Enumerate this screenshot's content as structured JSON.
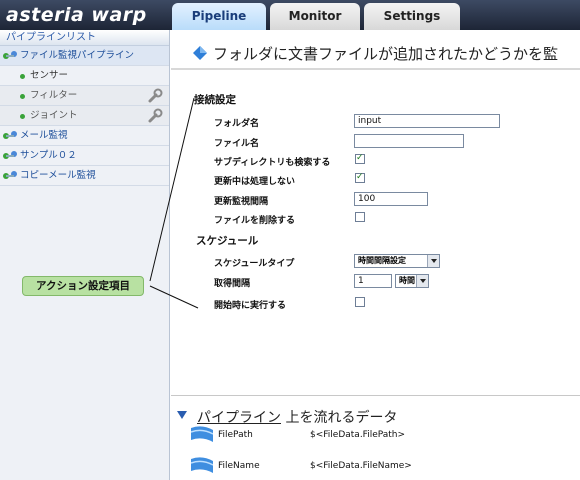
{
  "app": {
    "logo": "asteria warp"
  },
  "tabs": [
    {
      "label": "Pipeline",
      "active": true
    },
    {
      "label": "Monitor",
      "active": false
    },
    {
      "label": "Settings",
      "active": false
    }
  ],
  "sidebar": {
    "header": "パイプラインリスト",
    "items": [
      {
        "label": "ファイル監視パイプライン",
        "level": 1
      },
      {
        "label": "センサー",
        "level": 2
      },
      {
        "label": "フィルター",
        "level": 2
      },
      {
        "label": "ジョイント",
        "level": 2
      },
      {
        "label": "メール監視",
        "level": 1
      },
      {
        "label": "サンプル０２",
        "level": 1
      },
      {
        "label": "コピーメール監視",
        "level": 1
      }
    ]
  },
  "main": {
    "title": "フォルダに文書ファイルが追加されたかどうかを監",
    "section_connection": "接続設定",
    "fields": {
      "folder_label": "フォルダ名",
      "folder_value": "input",
      "file_label": "ファイル名",
      "file_value": "",
      "subdir_label": "サブディレクトリも検索する",
      "subdir_checked": true,
      "skip_updating_label": "更新中は処理しない",
      "skip_updating_checked": true,
      "interval_label": "更新監視間隔",
      "interval_value": "100",
      "delete_label": "ファイルを削除する",
      "delete_checked": false
    },
    "section_schedule": "スケジュール",
    "schedule": {
      "type_label": "スケジュールタイプ",
      "type_value": "時間間隔設定",
      "fetch_label": "取得間隔",
      "fetch_value": "1",
      "fetch_unit": "時間",
      "run_on_start_label": "開始時に実行する",
      "run_on_start_checked": false
    },
    "callout": "アクション設定項目",
    "data_section": {
      "title_prefix": "パイプライン",
      "title_suffix": " 上を流れるデータ",
      "rows": [
        {
          "name": "FilePath",
          "value": "$<FileData.FilePath>"
        },
        {
          "name": "FileName",
          "value": "$<FileData.FileName>"
        }
      ]
    }
  },
  "colors": {
    "topbar": "#1d2536",
    "active_tab": "#b9dcfa",
    "sidebar_bg": "#eef1f6",
    "callout_bg": "#b8e1a2",
    "accent": "#2a5db0"
  }
}
